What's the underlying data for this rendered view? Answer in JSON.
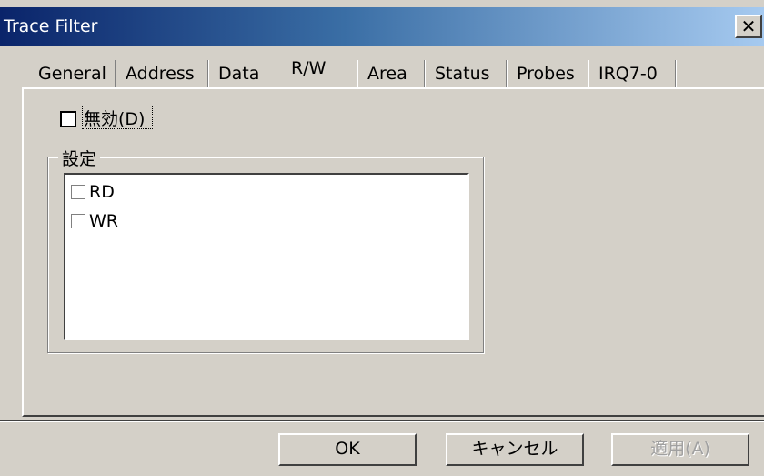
{
  "window": {
    "title": "Trace Filter",
    "close_label": "✕"
  },
  "tabs": [
    {
      "label": "General"
    },
    {
      "label": "Address"
    },
    {
      "label": "Data"
    },
    {
      "label": "R/W"
    },
    {
      "label": "Area"
    },
    {
      "label": "Status"
    },
    {
      "label": "Probes"
    },
    {
      "label": "IRQ7-0"
    }
  ],
  "selected_tab": "R/W",
  "disable_checkbox": {
    "label": "無効(D)",
    "checked": false
  },
  "settings_group": {
    "label": "設定",
    "items": [
      {
        "label": "RD",
        "checked": false
      },
      {
        "label": "WR",
        "checked": false
      }
    ]
  },
  "buttons": {
    "ok": "OK",
    "cancel": "キャンセル",
    "apply": "適用(A)"
  }
}
